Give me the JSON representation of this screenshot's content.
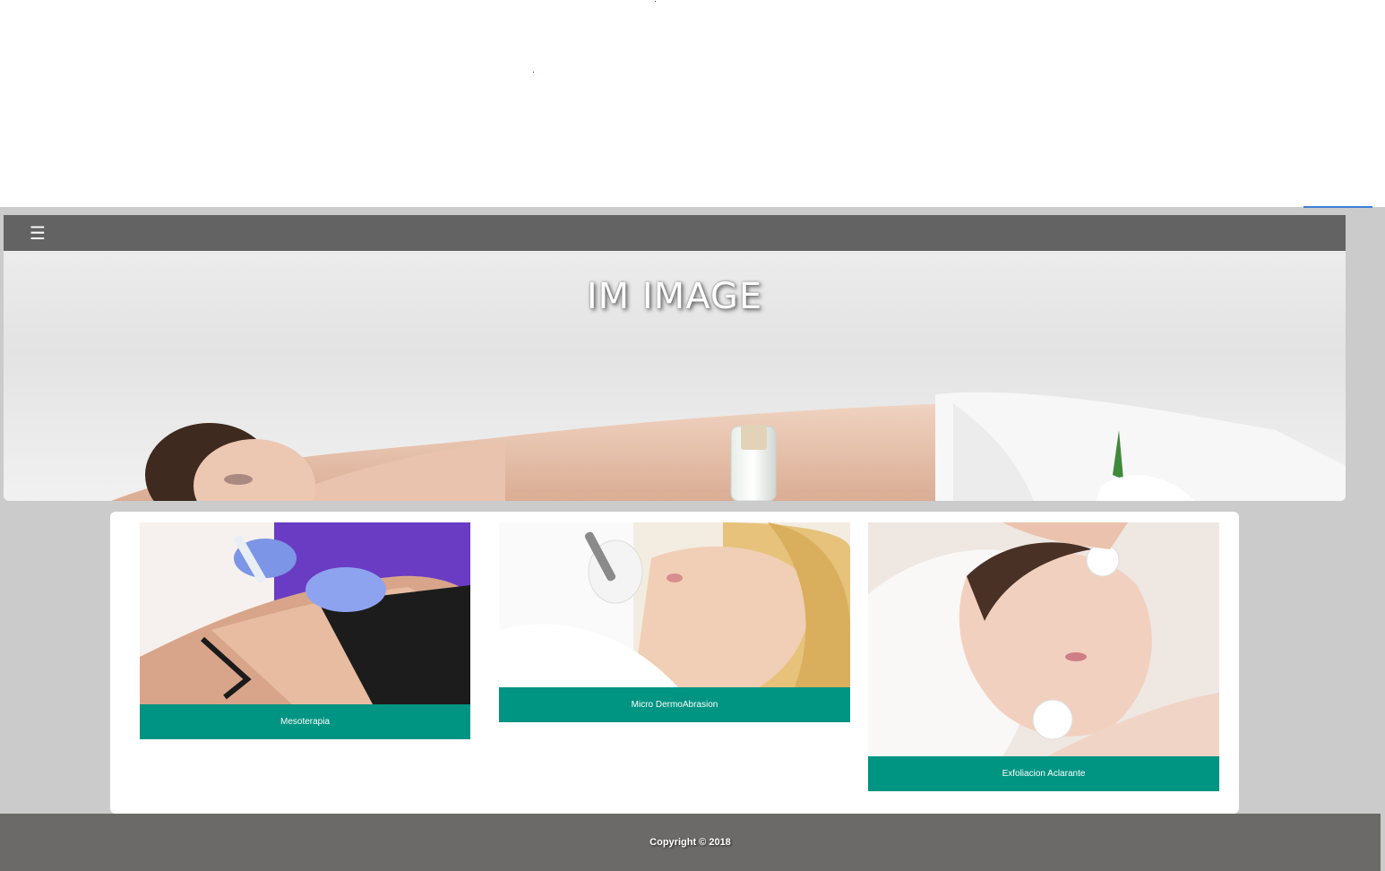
{
  "navbar": {
    "menu_icon": "hamburger-icon",
    "menu_glyph": "☰"
  },
  "hero": {
    "title": "IM IMAGE"
  },
  "services": [
    {
      "caption": "Mesoterapia",
      "image": "mesotherapy-treatment-photo"
    },
    {
      "caption": "Micro DermoAbrasion",
      "image": "microdermabrasion-treatment-photo"
    },
    {
      "caption": "Exfoliacion Aclarante",
      "image": "facial-exfoliation-photo"
    }
  ],
  "footer": {
    "copyright": "Copyright © 2018"
  },
  "colors": {
    "nav": "#636363",
    "caption": "#009482",
    "footer": "#6c6a68",
    "page": "#cbcbcb"
  }
}
